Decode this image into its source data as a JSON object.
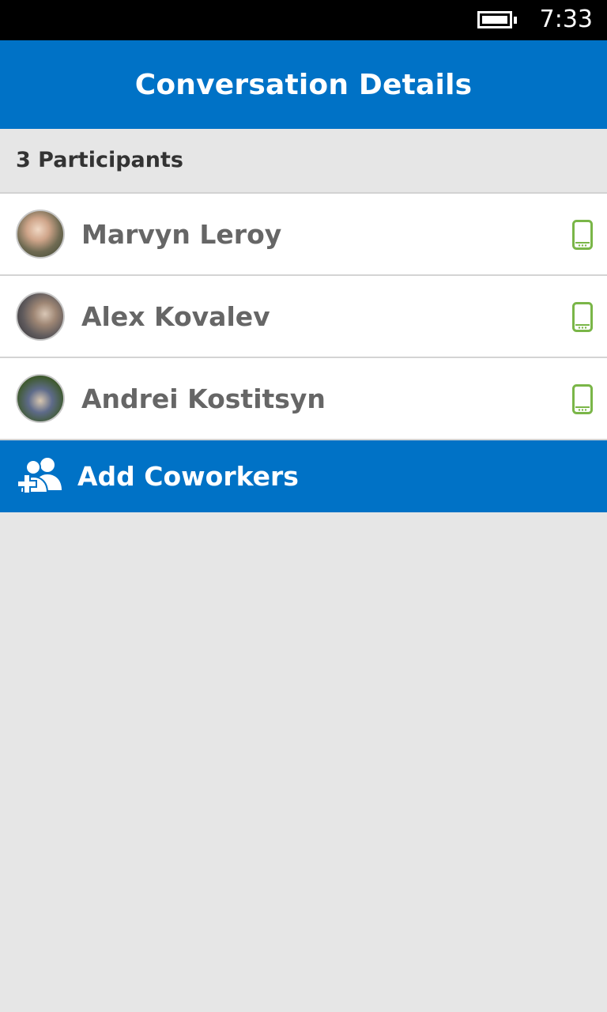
{
  "status_bar": {
    "time": "7:33",
    "battery_icon": "battery-icon"
  },
  "header": {
    "title": "Conversation Details"
  },
  "participants": {
    "count_label": "3 Participants",
    "items": [
      {
        "name": "Marvyn Leroy",
        "device_icon": "mobile-phone-icon"
      },
      {
        "name": "Alex Kovalev",
        "device_icon": "mobile-phone-icon"
      },
      {
        "name": "Andrei Kostitsyn",
        "device_icon": "mobile-phone-icon"
      }
    ]
  },
  "actions": {
    "add_coworkers_label": "Add Coworkers",
    "add_coworkers_icon": "add-people-icon"
  },
  "colors": {
    "accent": "#0072c6",
    "device_icon": "#7ab648",
    "background": "#e6e6e6"
  }
}
